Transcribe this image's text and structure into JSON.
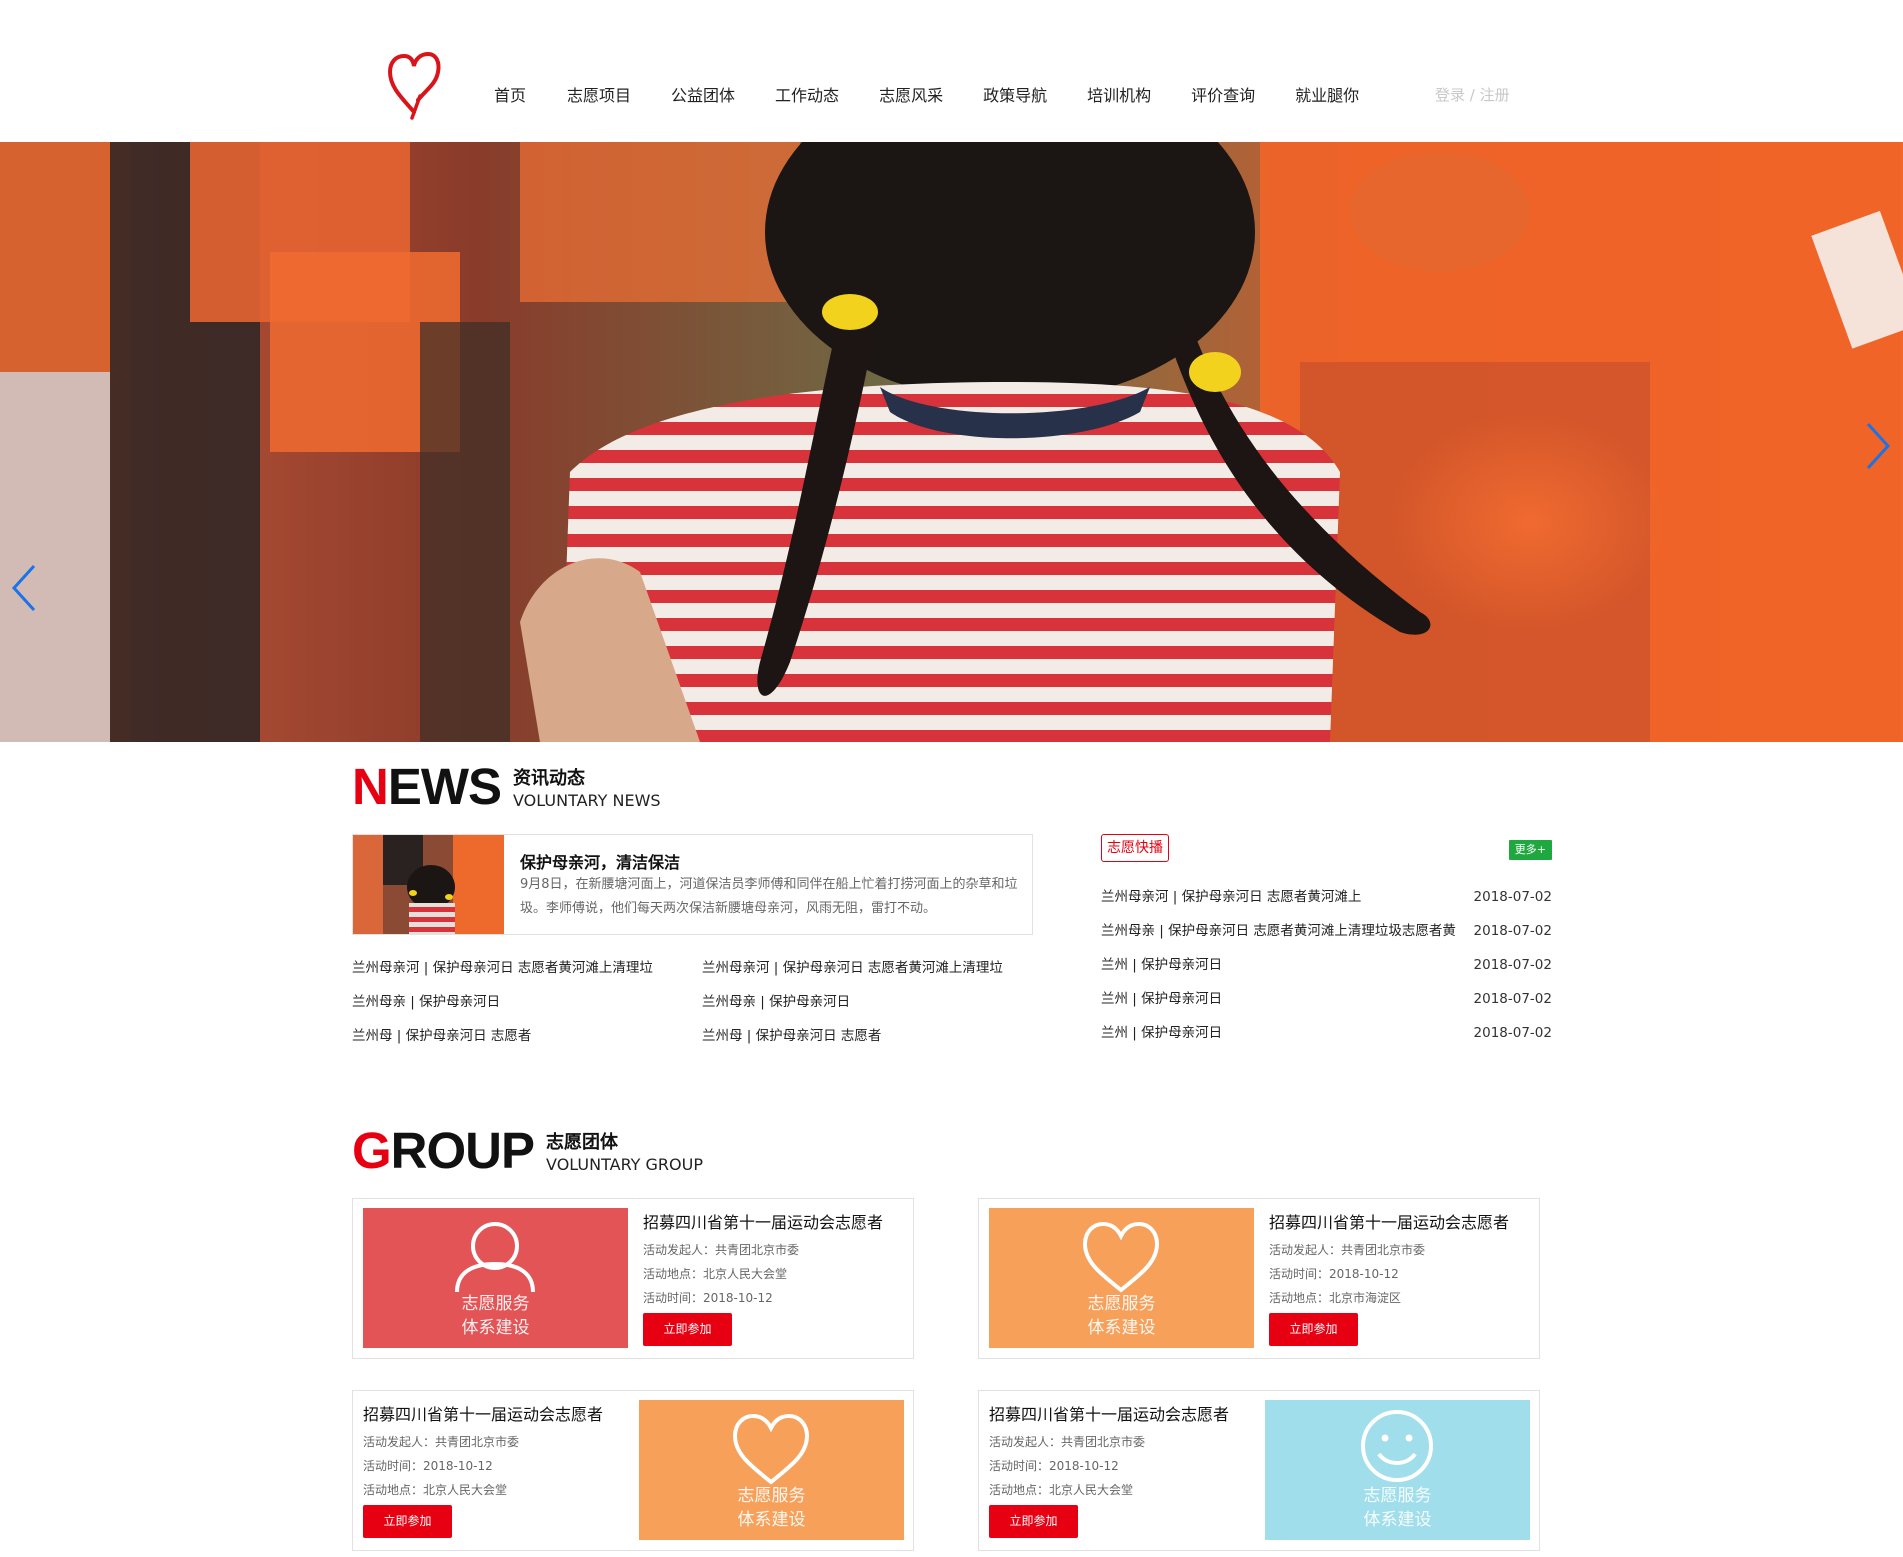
{
  "header": {
    "logo": "heart-logo",
    "nav": [
      "首页",
      "志愿项目",
      "公益团体",
      "工作动态",
      "志愿风采",
      "政策导航",
      "培训机构",
      "评价查询",
      "就业腿你"
    ],
    "login_label": "登录",
    "separator": " / ",
    "register_label": "注册"
  },
  "banner": {
    "prev_icon": "chevron-left-icon",
    "next_icon": "chevron-right-icon",
    "accent_color": "#1a73e8"
  },
  "news": {
    "title_first": "N",
    "title_rest": "EWS",
    "cn": "资讯动态",
    "en": "VOLUNTARY NEWS",
    "feature": {
      "title": "保护母亲河，清洁保洁",
      "desc": "9月8日，在新腰塘河面上，河道保洁员李师傅和同伴在船上忙着打捞河面上的杂草和垃圾。李师傅说，他们每天两次保洁新腰塘母亲河，风雨无阻，雷打不动。"
    },
    "col1": [
      "兰州母亲河 | 保护母亲河日 志愿者黄河滩上清理垃",
      "兰州母亲 | 保护母亲河日",
      "兰州母 | 保护母亲河日 志愿者"
    ],
    "col2": [
      "兰州母亲河 | 保护母亲河日 志愿者黄河滩上清理垃",
      "兰州母亲 | 保护母亲河日",
      "兰州母 | 保护母亲河日 志愿者"
    ]
  },
  "quick": {
    "tag": "志愿快播",
    "more": "更多+",
    "items": [
      {
        "title": "兰州母亲河 | 保护母亲河日 志愿者黄河滩上",
        "date": "2018-07-02"
      },
      {
        "title": "兰州母亲 | 保护母亲河日 志愿者黄河滩上清理垃圾志愿者黄",
        "date": "2018-07-02"
      },
      {
        "title": "兰州 | 保护母亲河日",
        "date": "2018-07-02"
      },
      {
        "title": "兰州 | 保护母亲河日",
        "date": "2018-07-02"
      },
      {
        "title": "兰州 | 保护母亲河日",
        "date": "2018-07-02"
      }
    ]
  },
  "group": {
    "title_first": "G",
    "title_rest": "ROUP",
    "cn": "志愿团体",
    "en": "VOLUNTARY GROUP",
    "cards": [
      {
        "title": "招募四川省第十一届运动会志愿者",
        "info": [
          "活动发起人：共青团北京市委",
          "活动地点：北京人民大会堂",
          "活动时间：2018-10-12"
        ],
        "button": "立即参加",
        "img_line1": "志愿服务",
        "img_line2": "体系建设",
        "img_color": "#e25456",
        "icon": "person-icon"
      },
      {
        "title": "招募四川省第十一届运动会志愿者",
        "info": [
          "活动发起人：共青团北京市委",
          "活动时间：2018-10-12",
          "活动地点：北京市海淀区"
        ],
        "button": "立即参加",
        "img_line1": "志愿服务",
        "img_line2": "体系建设",
        "img_color": "#f6a05a",
        "icon": "heart-icon"
      },
      {
        "title": "招募四川省第十一届运动会志愿者",
        "info": [
          "活动发起人：共青团北京市委",
          "活动时间：2018-10-12",
          "活动地点：北京人民大会堂"
        ],
        "button": "立即参加",
        "img_line1": "志愿服务",
        "img_line2": "体系建设",
        "img_color": "#f6a05a",
        "icon": "heart-icon"
      },
      {
        "title": "招募四川省第十一届运动会志愿者",
        "info": [
          "活动发起人：共青团北京市委",
          "活动时间：2018-10-12",
          "活动地点：北京人民大会堂"
        ],
        "button": "立即参加",
        "img_line1": "志愿服务",
        "img_line2": "体系建设",
        "img_color": "#9fdeea",
        "icon": "smile-icon"
      }
    ]
  }
}
